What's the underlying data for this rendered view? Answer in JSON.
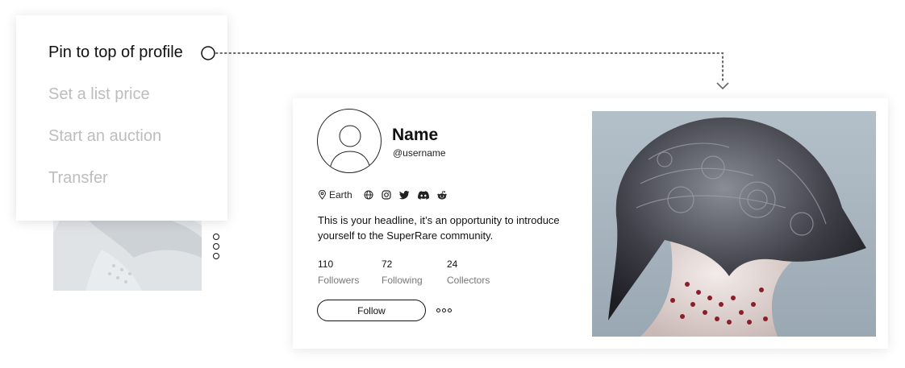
{
  "menu": {
    "items": [
      {
        "label": "Pin to top of profile",
        "active": true
      },
      {
        "label": "Set a list price",
        "active": false
      },
      {
        "label": "Start an auction",
        "active": false
      },
      {
        "label": "Transfer",
        "active": false
      }
    ]
  },
  "profile": {
    "name": "Name",
    "username": "@username",
    "location": "Earth",
    "location_icon": "location-pin-icon",
    "social_icons": [
      "globe-icon",
      "instagram-icon",
      "twitter-icon",
      "discord-icon",
      "reddit-icon"
    ],
    "headline": "This is your headline, it’s an opportunity to introduce yourself to the SuperRare community.",
    "stats": [
      {
        "value": "110",
        "label": "Followers"
      },
      {
        "value": "72",
        "label": "Following"
      },
      {
        "value": "24",
        "label": "Collectors"
      }
    ],
    "follow_label": "Follow"
  },
  "colors": {
    "text_primary": "#111111",
    "text_muted": "#bdbdbd",
    "artwork_bg": "#a9b6c0"
  }
}
